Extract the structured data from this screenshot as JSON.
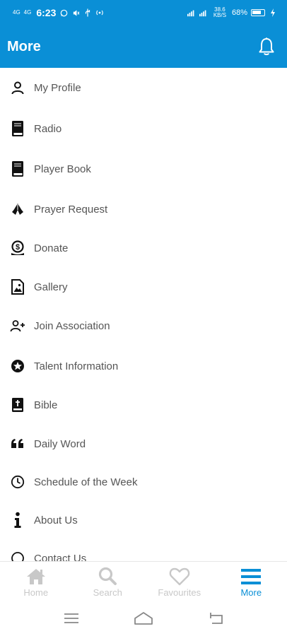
{
  "status_bar": {
    "network_left": "4G",
    "network_left2": "4G",
    "time": "6:23",
    "speed": "38.6 KB/S",
    "battery": "68%"
  },
  "header": {
    "title": "More",
    "notification_icon": "bell-icon"
  },
  "menu": {
    "items": [
      {
        "label": "My Profile",
        "icon": "user-icon"
      },
      {
        "label": "Radio",
        "icon": "book-icon"
      },
      {
        "label": "Player Book",
        "icon": "book-icon"
      },
      {
        "label": "Prayer Request",
        "icon": "praying-hands-icon"
      },
      {
        "label": "Donate",
        "icon": "donate-icon"
      },
      {
        "label": "Gallery",
        "icon": "image-icon"
      },
      {
        "label": "Join Association",
        "icon": "user-plus-icon"
      },
      {
        "label": "Talent Information",
        "icon": "star-circle-icon"
      },
      {
        "label": "Bible",
        "icon": "bible-icon"
      },
      {
        "label": "Daily Word",
        "icon": "quote-icon"
      },
      {
        "label": "Schedule of the Week",
        "icon": "clock-icon"
      },
      {
        "label": "About Us",
        "icon": "info-icon"
      },
      {
        "label": "Contact Us",
        "icon": "phone-icon"
      }
    ]
  },
  "bottom_nav": {
    "tabs": [
      {
        "label": "Home",
        "icon": "home-icon",
        "active": false
      },
      {
        "label": "Search",
        "icon": "search-icon",
        "active": false
      },
      {
        "label": "Favourites",
        "icon": "heart-icon",
        "active": false
      },
      {
        "label": "More",
        "icon": "menu-icon",
        "active": true
      }
    ]
  },
  "colors": {
    "primary": "#0a8fd6",
    "inactive": "#c8c8c8",
    "text": "#555555"
  }
}
